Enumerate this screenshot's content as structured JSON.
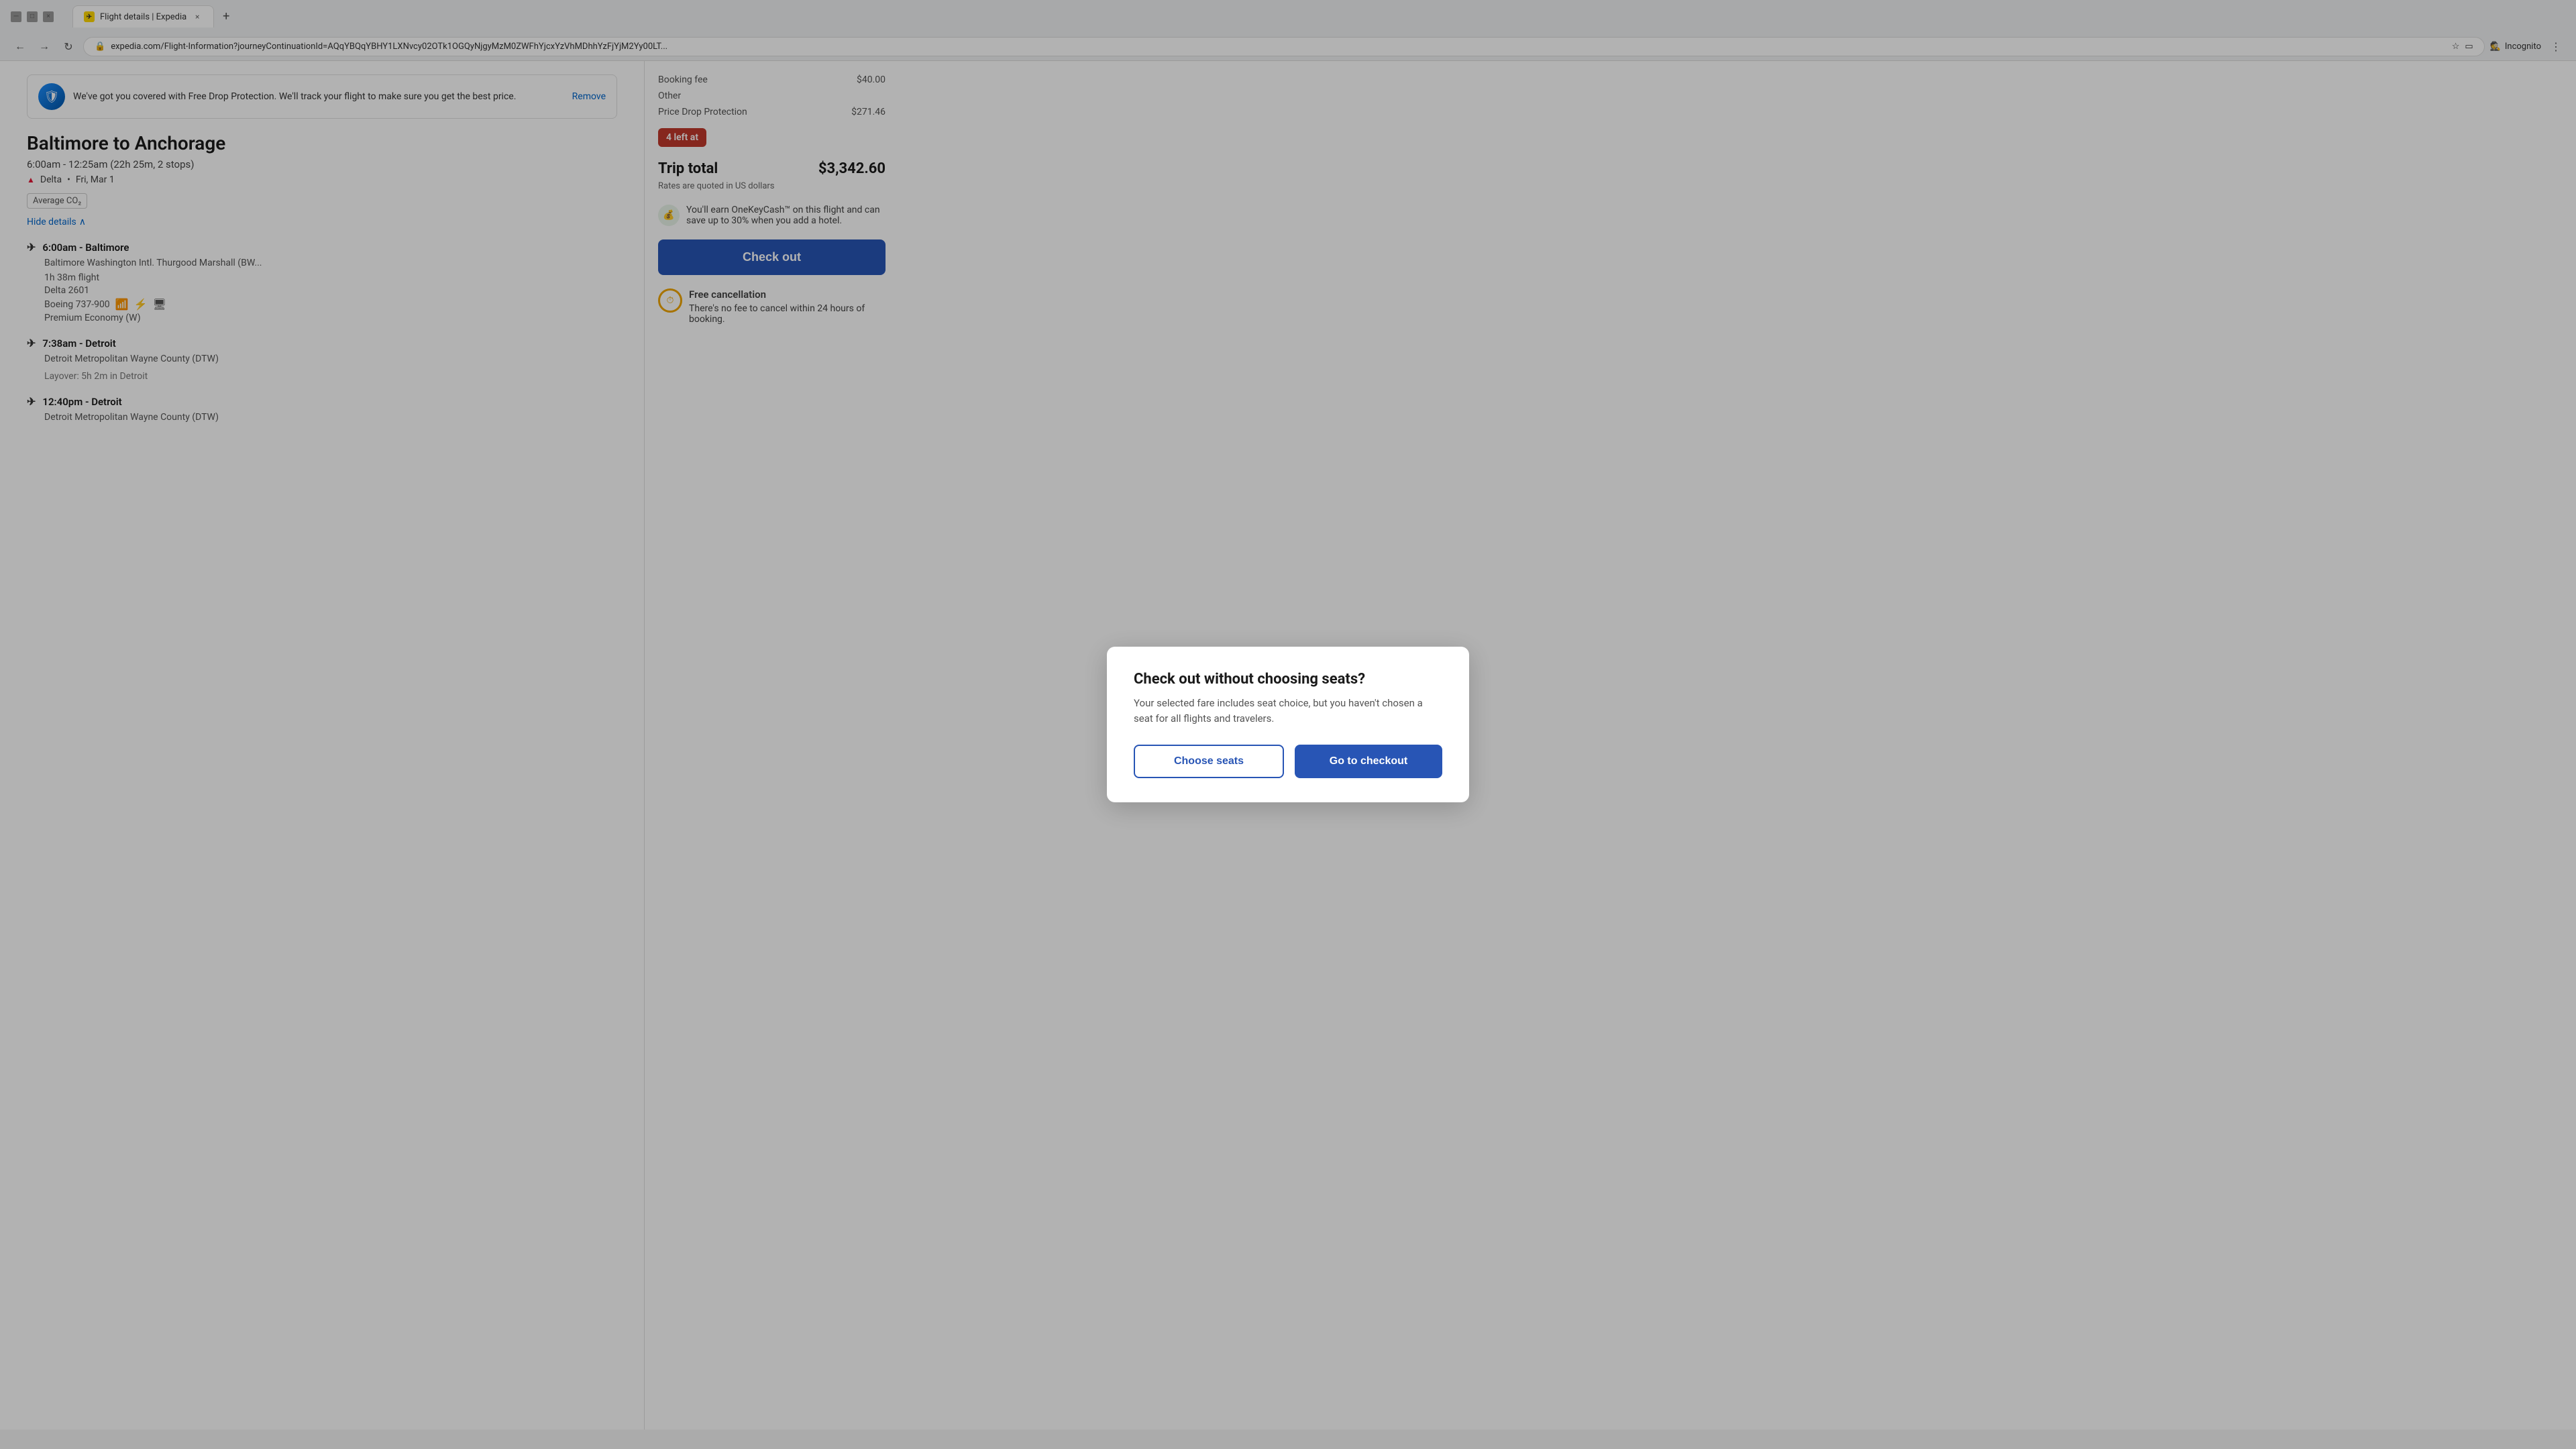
{
  "browser": {
    "tab_title": "Flight details | Expedia",
    "tab_favicon": "✈",
    "url": "expedia.com/Flight-Information?journeyContinuationId=AQqYBQqYBHY1LXNvcy02OTk1OGQyNjgyMzM0ZWFhYjcxYzVhMDhhYzFjYjM2Yy00LT...",
    "incognito_label": "Incognito",
    "close_btn": "×",
    "new_tab_btn": "+"
  },
  "promo": {
    "text": "We've got you covered with Free Drop Protection. We'll track your flight to make sure you get the best price.",
    "remove_label": "Remove"
  },
  "flight": {
    "route": "Baltimore to Anchorage",
    "schedule": "6:00am - 12:25am (22h 25m, 2 stops)",
    "airline": "Delta",
    "date": "Fri, Mar 1",
    "co2_label": "Average CO₂",
    "hide_details": "Hide details",
    "legs": [
      {
        "time": "6:00am - Baltimore",
        "airport": "Baltimore Washington Intl. Thurgood Marshall (BW...",
        "duration": "1h 38m flight",
        "flight_number": "Delta 2601",
        "aircraft": "Boeing 737-900",
        "cabin": "Premium Economy (W)"
      },
      {
        "time": "7:38am - Detroit",
        "airport": "Detroit Metropolitan Wayne County (DTW)",
        "layover": "Layover: 5h 2m in Detroit"
      },
      {
        "time": "12:40pm - Detroit",
        "airport": "Detroit Metropolitan Wayne County (DTW)"
      }
    ]
  },
  "sidebar": {
    "booking_fee_label": "Booking fee",
    "booking_fee_value": "$40.00",
    "other_label": "Other",
    "price_drop_label": "Price Drop Protection",
    "price_drop_value": "$271.46",
    "availability_badge": "4 left at",
    "trip_total_label": "Trip total",
    "trip_total_value": "$3,342.60",
    "quoted_text": "Rates are quoted in US dollars",
    "onekeycash_text": "You'll earn OneKeyCash™ on this flight and can save up to 30% when you add a hotel.",
    "checkout_btn_label": "Check out",
    "free_cancel_title": "Free cancellation",
    "free_cancel_text": "There's no fee to cancel within 24 hours of booking."
  },
  "modal": {
    "title": "Check out without choosing seats?",
    "body": "Your selected fare includes seat choice, but you haven't chosen a seat for all flights and travelers.",
    "choose_seats_label": "Choose seats",
    "go_to_checkout_label": "Go to checkout"
  }
}
